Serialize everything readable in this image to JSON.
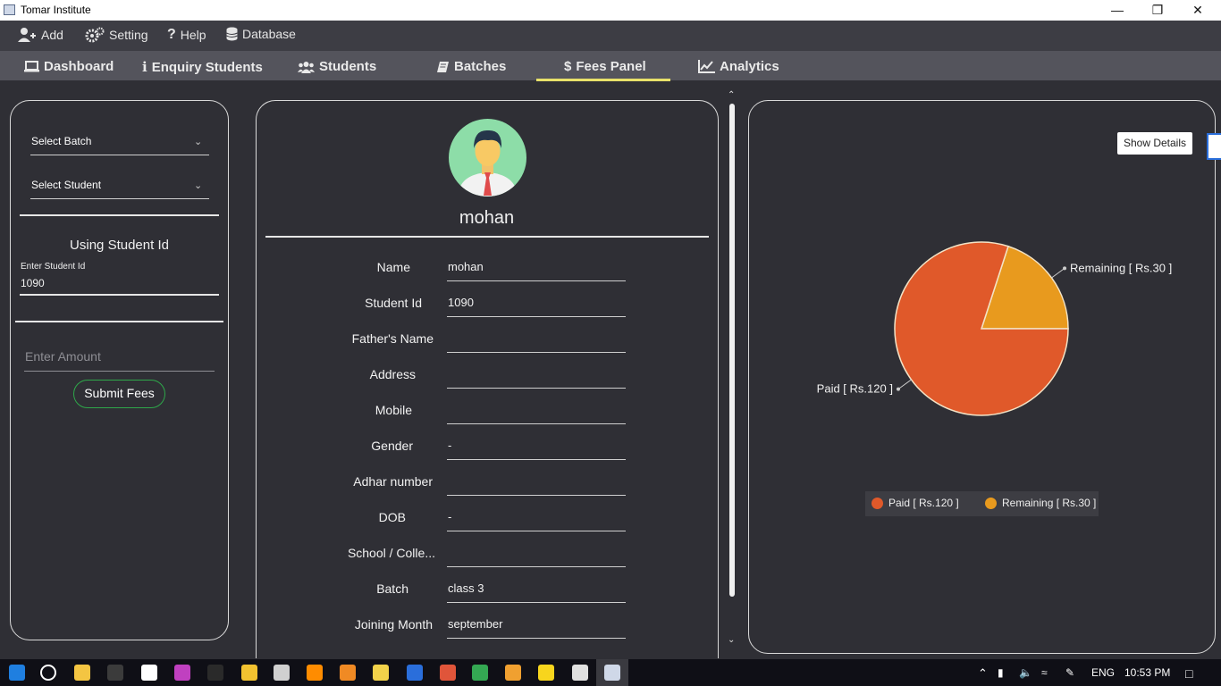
{
  "window": {
    "title": "Tomar Institute",
    "controls": [
      "minimize-icon",
      "restore-icon",
      "close-icon"
    ]
  },
  "menu": [
    {
      "label": "Add",
      "icon": "add-user-icon"
    },
    {
      "label": "Setting",
      "icon": "gears-icon"
    },
    {
      "label": "Help",
      "icon": "question-icon"
    },
    {
      "label": "Database",
      "icon": "database-icon"
    }
  ],
  "tabs": [
    {
      "label": "Dashboard",
      "icon": "laptop-icon"
    },
    {
      "label": "Enquiry Students",
      "icon": "info-icon"
    },
    {
      "label": "Students",
      "icon": "users-icon"
    },
    {
      "label": "Batches",
      "icon": "book-icon"
    },
    {
      "label": "Fees Panel",
      "icon": "dollar-icon",
      "active": true
    },
    {
      "label": "Analytics",
      "icon": "line-chart-icon"
    }
  ],
  "left": {
    "select_batch": "Select Batch",
    "select_student": "Select Student",
    "using_id_title": "Using Student Id",
    "student_id_label": "Enter Student Id",
    "student_id_value": "1090",
    "amount_placeholder": "Enter Amount",
    "submit_label": "Submit Fees"
  },
  "profile": {
    "name": "mohan",
    "fields": [
      {
        "label": "Name",
        "value": "mohan"
      },
      {
        "label": "Student Id",
        "value": "1090"
      },
      {
        "label": "Father's Name",
        "value": ""
      },
      {
        "label": "Address",
        "value": ""
      },
      {
        "label": "Mobile",
        "value": ""
      },
      {
        "label": "Gender",
        "value": "-"
      },
      {
        "label": "Adhar number",
        "value": ""
      },
      {
        "label": "DOB",
        "value": "-"
      },
      {
        "label": "School / Colle...",
        "value": ""
      },
      {
        "label": "Batch",
        "value": "class 3"
      },
      {
        "label": "Joining Month",
        "value": "september"
      }
    ]
  },
  "chart_panel": {
    "show_details_label": "Show Details"
  },
  "chart_data": {
    "type": "pie",
    "categories": [
      "Paid [ Rs.120 ]",
      "Remaining [ Rs.30 ]"
    ],
    "values": [
      120,
      30
    ],
    "colors": [
      "#e0592a",
      "#e89a1e"
    ],
    "legend_position": "bottom"
  },
  "taskbar": {
    "lang": "ENG",
    "time": "10:53 PM",
    "apps": [
      "start-icon",
      "cortana-icon",
      "file-explorer-icon",
      "terminal-icon",
      "maps-icon",
      "paint-icon",
      "cmd-icon",
      "app-icon",
      "browser-icon",
      "vlc-icon",
      "sublime-icon",
      "mail-icon",
      "java-icon",
      "git-icon",
      "chrome-icon",
      "firefox-icon",
      "sticky-notes-icon",
      "box-icon",
      "java-app-icon"
    ]
  }
}
